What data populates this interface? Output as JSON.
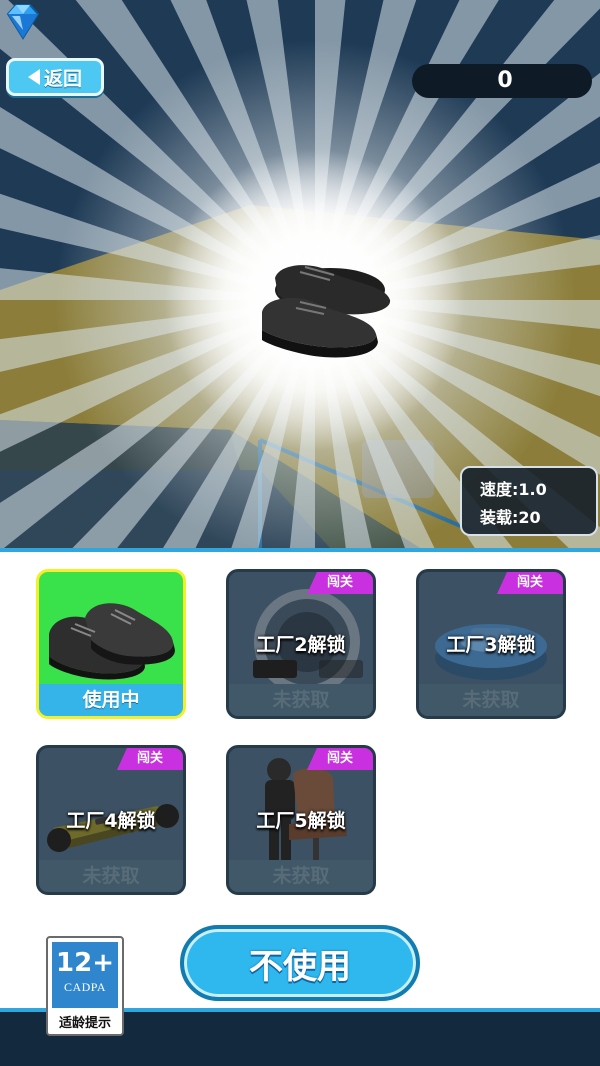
{
  "header": {
    "back_label": "返回",
    "gem_count": "0",
    "gem_icon": "diamond-icon"
  },
  "stats": {
    "speed": "速度:1.0",
    "capacity": "装载:20"
  },
  "items": [
    {
      "name": "black-shoes",
      "status": "使用中",
      "active": true
    },
    {
      "name": "unicycle",
      "tag": "闯关",
      "lock_text": "工厂2解锁",
      "status": "未获取"
    },
    {
      "name": "robot-vacuum",
      "tag": "闯关",
      "lock_text": "工厂3解锁",
      "status": "未获取"
    },
    {
      "name": "hoverboard",
      "tag": "闯关",
      "lock_text": "工厂4解锁",
      "status": "未获取"
    },
    {
      "name": "office-chair",
      "tag": "闯关",
      "lock_text": "工厂5解锁",
      "status": "未获取"
    }
  ],
  "actions": {
    "unuse_label": "不使用"
  },
  "age_rating": {
    "age": "12+",
    "org": "CADPA",
    "tip": "适龄提示"
  },
  "colors": {
    "accent_blue": "#2fb8ee",
    "active_green": "#39e24a",
    "tag_purple": "#c931e0"
  }
}
